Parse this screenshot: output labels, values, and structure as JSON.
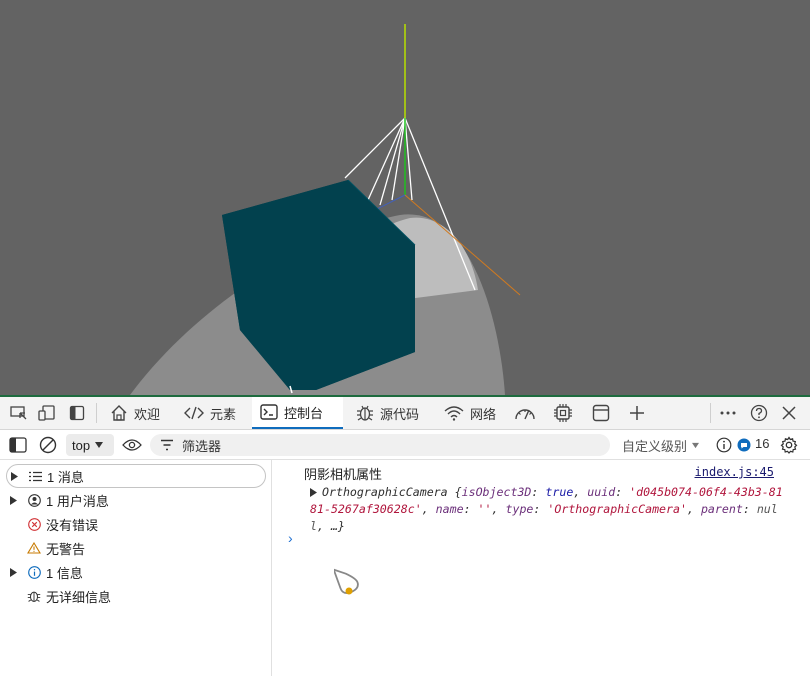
{
  "tabs": [
    {
      "label": "欢迎",
      "icon": "home-icon"
    },
    {
      "label": "元素",
      "icon": "code-icon"
    },
    {
      "label": "控制台",
      "icon": "console-icon",
      "active": true
    },
    {
      "label": "源代码",
      "icon": "bug-icon"
    },
    {
      "label": "网络",
      "icon": "wifi-icon"
    }
  ],
  "console_toolbar": {
    "context": "top",
    "filter_placeholder": "筛选器",
    "levels_label": "自定义级别",
    "issues_count": "16"
  },
  "sidebar": {
    "items": [
      {
        "label": "1 消息",
        "icon": "list-icon",
        "expandable": true,
        "selected": true
      },
      {
        "label": "1 用户消息",
        "icon": "user-icon",
        "expandable": true
      },
      {
        "label": "没有错误",
        "icon": "error-icon",
        "expandable": false
      },
      {
        "label": "无警告",
        "icon": "warning-icon",
        "expandable": false
      },
      {
        "label": "1 信息",
        "icon": "info-icon",
        "expandable": true
      },
      {
        "label": "无详细信息",
        "icon": "bug-icon",
        "expandable": false
      }
    ]
  },
  "console": {
    "log_text": "阴影相机属性",
    "source": "index.js:45",
    "object": {
      "class_name": "OrthographicCamera",
      "open": " {",
      "k1": "isObject3D",
      "v1": "true",
      "k2": "uuid",
      "v2": "'d045b074-06f4-43b3-8181-5267af30628c'",
      "k3": "name",
      "v3": "''",
      "k4": "type",
      "v4": "'OrthographicCamera'",
      "k5": "parent",
      "v5": "null",
      "tail": ", …}"
    },
    "prompt": "›"
  },
  "colors": {
    "viewport_bg": "#636363",
    "cube": "#03424f",
    "ground": "#c8c8c8",
    "accent": "#0f6cbd"
  }
}
